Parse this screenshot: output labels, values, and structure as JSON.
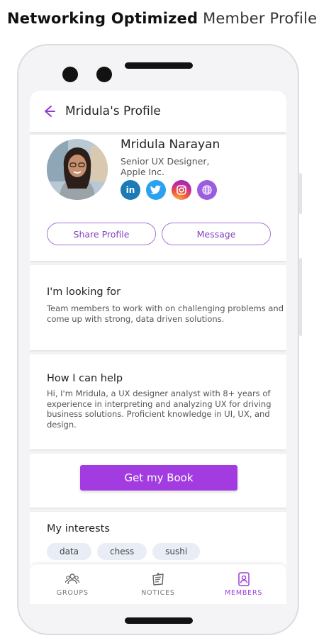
{
  "headline": {
    "bold": "Networking Optimized",
    "light": "Member Profile"
  },
  "appbar": {
    "title": "Mridula's Profile"
  },
  "profile": {
    "name": "Mridula Narayan",
    "role_line1": "Senior UX Designer,",
    "role_line2": "Apple Inc.",
    "socials": [
      "linkedin",
      "twitter",
      "instagram",
      "website"
    ],
    "share_label": "Share Profile",
    "message_label": "Message"
  },
  "looking_for": {
    "title": "I'm looking for",
    "text": "Team members to work with on challenging problems and come up with strong, data driven solutions."
  },
  "how_help": {
    "title": "How I can help",
    "text": "Hi, I'm Mridula, a UX designer analyst with 8+ years of experience in interpreting and analyzing UX  for driving business solutions. Proficient knowledge in UI, UX, and design."
  },
  "book": {
    "label": "Get my Book"
  },
  "interests": {
    "title": "My interests",
    "items": [
      "data",
      "chess",
      "sushi"
    ]
  },
  "nav": {
    "items": [
      {
        "label": "GROUPS",
        "icon": "groups-icon",
        "active": false
      },
      {
        "label": "NOTICES",
        "icon": "notices-icon",
        "active": false
      },
      {
        "label": "MEMBERS",
        "icon": "members-icon",
        "active": true
      }
    ]
  },
  "colors": {
    "accent": "#a23ce0",
    "outline": "#a774d6",
    "chip_bg": "#e9edf5"
  }
}
